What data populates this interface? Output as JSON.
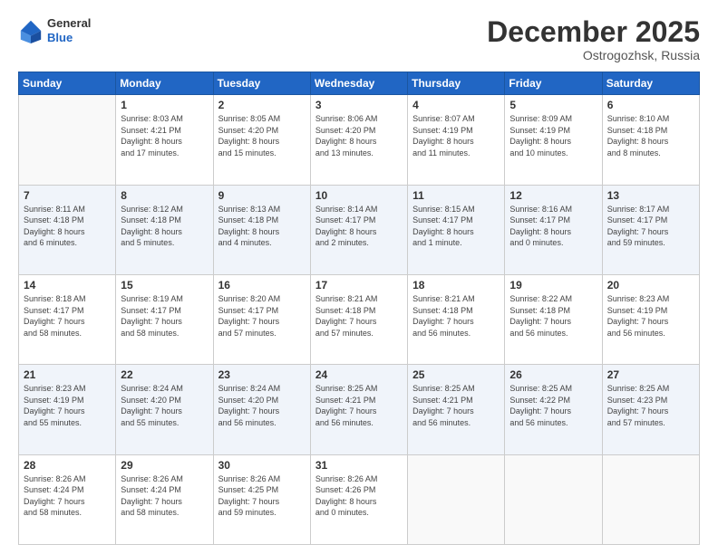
{
  "header": {
    "logo_general": "General",
    "logo_blue": "Blue",
    "month": "December 2025",
    "location": "Ostrogozhsk, Russia"
  },
  "weekdays": [
    "Sunday",
    "Monday",
    "Tuesday",
    "Wednesday",
    "Thursday",
    "Friday",
    "Saturday"
  ],
  "weeks": [
    [
      {
        "day": "",
        "info": ""
      },
      {
        "day": "1",
        "info": "Sunrise: 8:03 AM\nSunset: 4:21 PM\nDaylight: 8 hours\nand 17 minutes."
      },
      {
        "day": "2",
        "info": "Sunrise: 8:05 AM\nSunset: 4:20 PM\nDaylight: 8 hours\nand 15 minutes."
      },
      {
        "day": "3",
        "info": "Sunrise: 8:06 AM\nSunset: 4:20 PM\nDaylight: 8 hours\nand 13 minutes."
      },
      {
        "day": "4",
        "info": "Sunrise: 8:07 AM\nSunset: 4:19 PM\nDaylight: 8 hours\nand 11 minutes."
      },
      {
        "day": "5",
        "info": "Sunrise: 8:09 AM\nSunset: 4:19 PM\nDaylight: 8 hours\nand 10 minutes."
      },
      {
        "day": "6",
        "info": "Sunrise: 8:10 AM\nSunset: 4:18 PM\nDaylight: 8 hours\nand 8 minutes."
      }
    ],
    [
      {
        "day": "7",
        "info": "Sunrise: 8:11 AM\nSunset: 4:18 PM\nDaylight: 8 hours\nand 6 minutes."
      },
      {
        "day": "8",
        "info": "Sunrise: 8:12 AM\nSunset: 4:18 PM\nDaylight: 8 hours\nand 5 minutes."
      },
      {
        "day": "9",
        "info": "Sunrise: 8:13 AM\nSunset: 4:18 PM\nDaylight: 8 hours\nand 4 minutes."
      },
      {
        "day": "10",
        "info": "Sunrise: 8:14 AM\nSunset: 4:17 PM\nDaylight: 8 hours\nand 2 minutes."
      },
      {
        "day": "11",
        "info": "Sunrise: 8:15 AM\nSunset: 4:17 PM\nDaylight: 8 hours\nand 1 minute."
      },
      {
        "day": "12",
        "info": "Sunrise: 8:16 AM\nSunset: 4:17 PM\nDaylight: 8 hours\nand 0 minutes."
      },
      {
        "day": "13",
        "info": "Sunrise: 8:17 AM\nSunset: 4:17 PM\nDaylight: 7 hours\nand 59 minutes."
      }
    ],
    [
      {
        "day": "14",
        "info": "Sunrise: 8:18 AM\nSunset: 4:17 PM\nDaylight: 7 hours\nand 58 minutes."
      },
      {
        "day": "15",
        "info": "Sunrise: 8:19 AM\nSunset: 4:17 PM\nDaylight: 7 hours\nand 58 minutes."
      },
      {
        "day": "16",
        "info": "Sunrise: 8:20 AM\nSunset: 4:17 PM\nDaylight: 7 hours\nand 57 minutes."
      },
      {
        "day": "17",
        "info": "Sunrise: 8:21 AM\nSunset: 4:18 PM\nDaylight: 7 hours\nand 57 minutes."
      },
      {
        "day": "18",
        "info": "Sunrise: 8:21 AM\nSunset: 4:18 PM\nDaylight: 7 hours\nand 56 minutes."
      },
      {
        "day": "19",
        "info": "Sunrise: 8:22 AM\nSunset: 4:18 PM\nDaylight: 7 hours\nand 56 minutes."
      },
      {
        "day": "20",
        "info": "Sunrise: 8:23 AM\nSunset: 4:19 PM\nDaylight: 7 hours\nand 56 minutes."
      }
    ],
    [
      {
        "day": "21",
        "info": "Sunrise: 8:23 AM\nSunset: 4:19 PM\nDaylight: 7 hours\nand 55 minutes."
      },
      {
        "day": "22",
        "info": "Sunrise: 8:24 AM\nSunset: 4:20 PM\nDaylight: 7 hours\nand 55 minutes."
      },
      {
        "day": "23",
        "info": "Sunrise: 8:24 AM\nSunset: 4:20 PM\nDaylight: 7 hours\nand 56 minutes."
      },
      {
        "day": "24",
        "info": "Sunrise: 8:25 AM\nSunset: 4:21 PM\nDaylight: 7 hours\nand 56 minutes."
      },
      {
        "day": "25",
        "info": "Sunrise: 8:25 AM\nSunset: 4:21 PM\nDaylight: 7 hours\nand 56 minutes."
      },
      {
        "day": "26",
        "info": "Sunrise: 8:25 AM\nSunset: 4:22 PM\nDaylight: 7 hours\nand 56 minutes."
      },
      {
        "day": "27",
        "info": "Sunrise: 8:25 AM\nSunset: 4:23 PM\nDaylight: 7 hours\nand 57 minutes."
      }
    ],
    [
      {
        "day": "28",
        "info": "Sunrise: 8:26 AM\nSunset: 4:24 PM\nDaylight: 7 hours\nand 58 minutes."
      },
      {
        "day": "29",
        "info": "Sunrise: 8:26 AM\nSunset: 4:24 PM\nDaylight: 7 hours\nand 58 minutes."
      },
      {
        "day": "30",
        "info": "Sunrise: 8:26 AM\nSunset: 4:25 PM\nDaylight: 7 hours\nand 59 minutes."
      },
      {
        "day": "31",
        "info": "Sunrise: 8:26 AM\nSunset: 4:26 PM\nDaylight: 8 hours\nand 0 minutes."
      },
      {
        "day": "",
        "info": ""
      },
      {
        "day": "",
        "info": ""
      },
      {
        "day": "",
        "info": ""
      }
    ]
  ]
}
